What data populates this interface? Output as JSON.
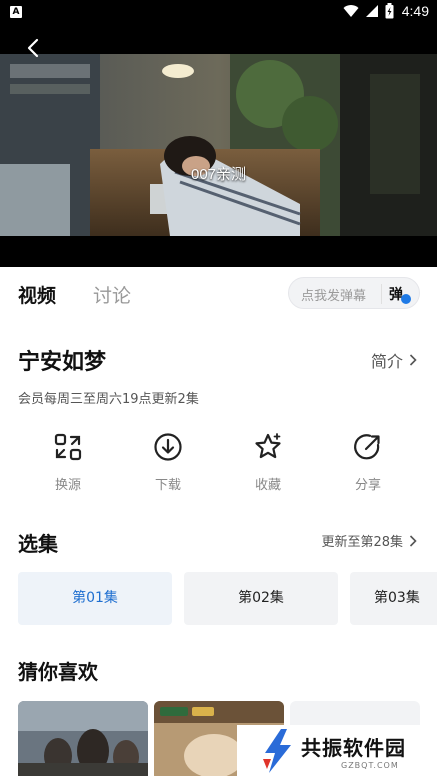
{
  "status_bar": {
    "time": "4:49",
    "app_badge": "A"
  },
  "player": {
    "subtitle": "007亲测"
  },
  "tabs": [
    {
      "label": "视频"
    },
    {
      "label": "讨论"
    }
  ],
  "danmaku": {
    "placeholder": "点我发弹幕",
    "toggle_label": "弹"
  },
  "show": {
    "title": "宁安如梦",
    "intro_label": "简介",
    "update_note": "会员每周三至周六19点更新2集"
  },
  "actions": [
    {
      "label": "换源",
      "icon": "switch-source-icon"
    },
    {
      "label": "下载",
      "icon": "download-icon"
    },
    {
      "label": "收藏",
      "icon": "star-icon"
    },
    {
      "label": "分享",
      "icon": "share-icon"
    }
  ],
  "episodes": {
    "title": "选集",
    "more_label": "更新至第28集",
    "items": [
      {
        "label": "第01集"
      },
      {
        "label": "第02集"
      },
      {
        "label": "第03集"
      }
    ]
  },
  "recommend": {
    "title": "猜你喜欢"
  },
  "watermark": {
    "text": "共振软件园",
    "sub": "GZBQT.COM"
  },
  "colors": {
    "accent": "#1f6fd0",
    "chip_bg": "#f2f3f5",
    "muted": "#888888"
  }
}
